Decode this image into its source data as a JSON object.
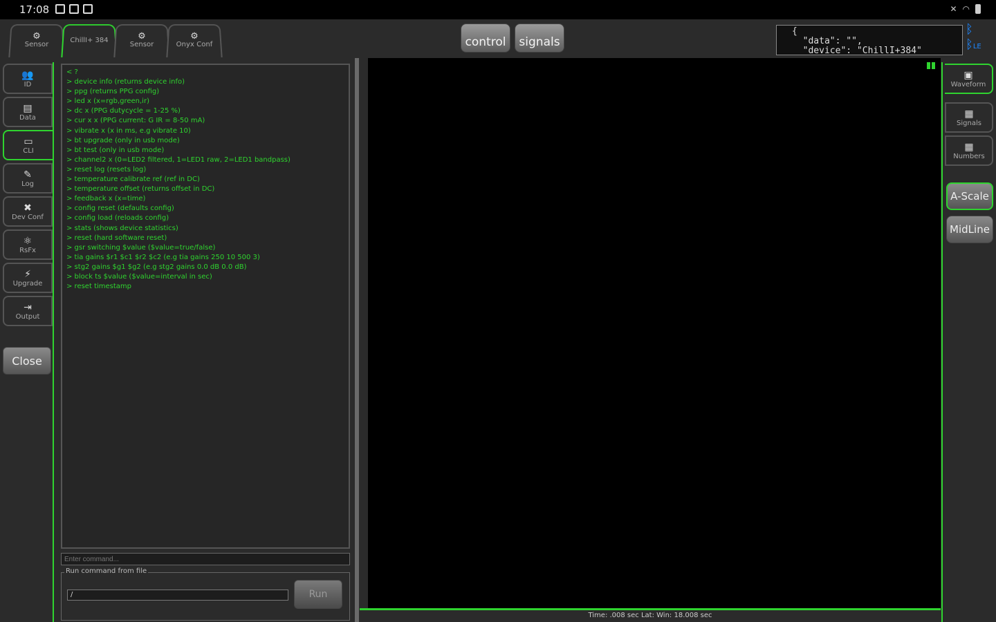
{
  "status": {
    "time": "17:08"
  },
  "top_tabs": [
    {
      "label": "Sensor",
      "icon": "⚙"
    },
    {
      "label": "ChillI+ 384",
      "icon": ""
    },
    {
      "label": "Sensor",
      "icon": "⚙"
    },
    {
      "label": "Onyx Conf",
      "icon": "⚙"
    }
  ],
  "top_buttons": {
    "control": "control",
    "signals": "signals"
  },
  "json_preview": "{\n  \"data\": \"\",\n  \"device\": \"ChillI+384\"",
  "bt": {
    "le": "LE"
  },
  "left_nav": [
    {
      "label": "ID",
      "icon": "👥"
    },
    {
      "label": "Data",
      "icon": "▤"
    },
    {
      "label": "CLI",
      "icon": "▭"
    },
    {
      "label": "Log",
      "icon": "✎"
    },
    {
      "label": "Dev Conf",
      "icon": "✖"
    },
    {
      "label": "RsFx",
      "icon": "⚛"
    },
    {
      "label": "Upgrade",
      "icon": "⚡"
    },
    {
      "label": "Output",
      "icon": "⇥"
    }
  ],
  "close_label": "Close",
  "cli_lines": [
    "< ?",
    "> device info (returns device info)",
    "> ppg (returns PPG config)",
    "> led x (x=rgb,green,ir)",
    "> dc x (PPG dutycycle = 1-25 %)",
    "> cur x x (PPG current: G IR = 8-50 mA)",
    "> vibrate x (x in ms, e.g vibrate 10)",
    "> bt upgrade (only in usb mode)",
    "> bt test (only in usb mode)",
    "> channel2 x (0=LED2 filtered, 1=LED1 raw, 2=LED1 bandpass)",
    "> reset log (resets log)",
    "> temperature calibrate ref (ref in DC)",
    "> temperature offset (returns offset in DC)",
    "> feedback x (x=time)",
    "> config reset (defaults config)",
    "> config load (reloads config)",
    "> stats (shows device statistics)",
    "> reset (hard software reset)",
    "> gsr switching $value ($value=true/false)",
    "> tia gains $r1 $c1 $r2 $c2 (e.g tia gains 250 10 500 3)",
    "> stg2 gains $g1 $g2 (e.g stg2 gains 0.0 dB 0.0 dB)",
    "> block ts $value ($value=interval in sec)",
    "> reset timestamp"
  ],
  "cmd_input": {
    "placeholder": "Enter command..."
  },
  "run_file": {
    "legend": "Run command from file",
    "selected": "/",
    "run_label": "Run"
  },
  "chart_footer": "Time: .008 sec    Lat:    Win: 18.008 sec",
  "right_nav": [
    {
      "label": "Waveform",
      "icon": "▣"
    },
    {
      "label": "Signals",
      "icon": "▦"
    },
    {
      "label": "Numbers",
      "icon": "▦"
    }
  ],
  "right_buttons": {
    "ascale": "A-Scale",
    "midline": "MidLine"
  },
  "colors": {
    "accent": "#2fd42f",
    "bg": "#2b2b2b",
    "chart_bg": "#000000",
    "bluetooth": "#1e88ff"
  }
}
